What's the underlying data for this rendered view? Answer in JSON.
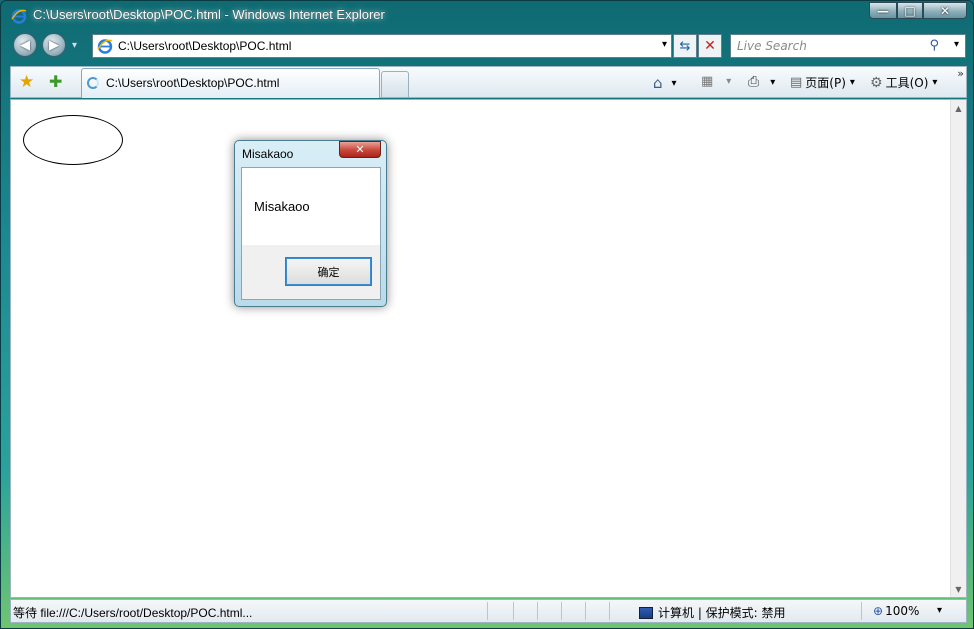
{
  "window": {
    "title": "C:\\Users\\root\\Desktop\\POC.html - Windows Internet Explorer",
    "controls": {
      "minimize": "—",
      "maximize": "□",
      "close": "✕"
    }
  },
  "navigation": {
    "back": "◀",
    "forward": "▶",
    "history_dropdown": "▾",
    "address": "C:\\Users\\root\\Desktop\\POC.html",
    "address_dropdown": "▾",
    "refresh": "⇆",
    "stop": "✕"
  },
  "search": {
    "placeholder": "Live Search",
    "icon": "⚲",
    "dropdown": "▾"
  },
  "toolbar": {
    "favorites_icon": "★",
    "add_favorite_icon": "✚",
    "tab_label": "C:\\Users\\root\\Desktop\\POC.html",
    "home_icon": "⌂",
    "feeds_icon": "▦",
    "print_icon": "⎙",
    "page_icon": "▤",
    "page_label": "页面(P)",
    "tools_icon": "⚙",
    "tools_label": "工具(O)",
    "dropdown": "▾",
    "chevron": "»"
  },
  "dialog": {
    "title": "Misakaoo",
    "message": "Misakaoo",
    "ok_label": "确定",
    "close": "✕"
  },
  "status": {
    "text": "等待 file:///C:/Users/root/Desktop/POC.html...",
    "zone": "计算机 | 保护模式: 禁用",
    "zoom": "100%",
    "zoom_icon": "⊕",
    "zoom_dropdown": "▾"
  },
  "scroll": {
    "up": "▲",
    "down": "▼"
  }
}
